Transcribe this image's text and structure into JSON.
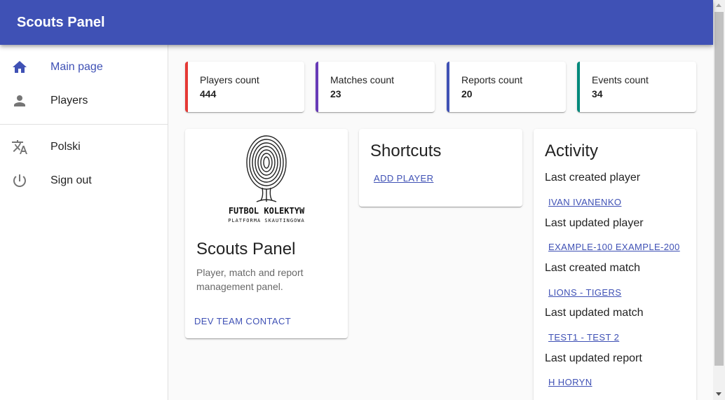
{
  "appbar": {
    "title": "Scouts Panel"
  },
  "sidebar": {
    "items": [
      {
        "label": "Main page",
        "icon": "home-icon"
      },
      {
        "label": "Players",
        "icon": "person-icon"
      },
      {
        "label": "Polski",
        "icon": "translate-icon"
      },
      {
        "label": "Sign out",
        "icon": "power-icon"
      }
    ],
    "active_color": "#3f51b5"
  },
  "stats": [
    {
      "label": "Players count",
      "value": "444",
      "color": "#e53935"
    },
    {
      "label": "Matches count",
      "value": "23",
      "color": "#673ab7"
    },
    {
      "label": "Reports count",
      "value": "20",
      "color": "#3f51b5"
    },
    {
      "label": "Events count",
      "value": "34",
      "color": "#00897b"
    }
  ],
  "info_card": {
    "logo_text": "FUTBOL KOLEKTYW",
    "logo_subtext": "PLATFORMA SKAUTINGOWA",
    "title": "Scouts Panel",
    "description": "Player, match and report management panel.",
    "contact_button": "DEV TEAM CONTACT"
  },
  "shortcuts": {
    "title": "Shortcuts",
    "links": [
      "ADD PLAYER"
    ]
  },
  "activity": {
    "title": "Activity",
    "entries": [
      {
        "label": "Last created player",
        "link": "IVAN IVANENKO"
      },
      {
        "label": "Last updated player",
        "link": "EXAMPLE-100 EXAMPLE-200"
      },
      {
        "label": "Last created match",
        "link": "LIONS - TIGERS"
      },
      {
        "label": "Last updated match",
        "link": "TEST1 - TEST 2"
      },
      {
        "label": "Last updated report",
        "link": "H HORYN"
      }
    ]
  },
  "colors": {
    "primary": "#3f51b5",
    "background": "#fafafa"
  }
}
